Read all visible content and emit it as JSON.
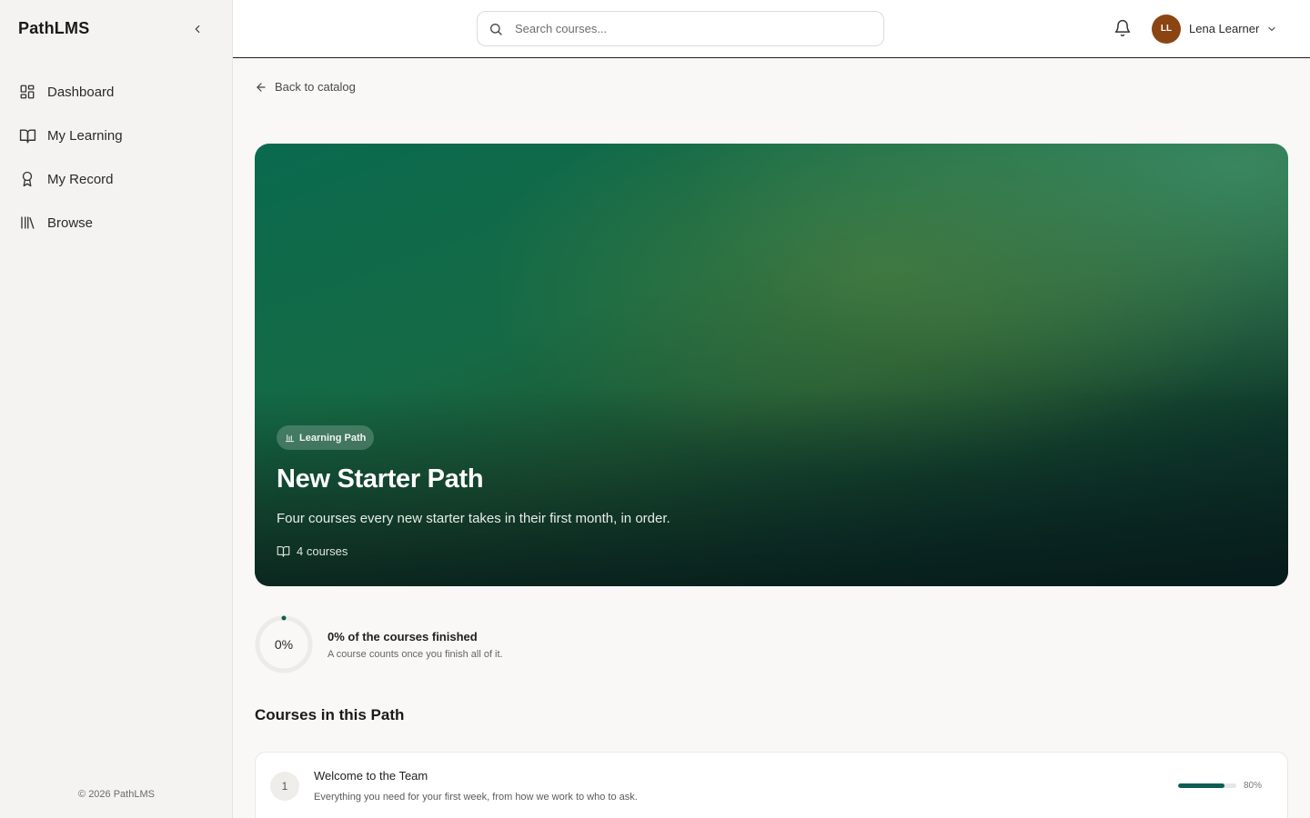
{
  "sidebar": {
    "brand": "PathLMS",
    "items": [
      {
        "label": "Dashboard",
        "icon": "dashboard-icon"
      },
      {
        "label": "My Learning",
        "icon": "book-open-icon"
      },
      {
        "label": "My Record",
        "icon": "award-icon"
      },
      {
        "label": "Browse",
        "icon": "library-icon"
      }
    ],
    "footer": "© 2026 PathLMS"
  },
  "topbar": {
    "search_placeholder": "Search courses...",
    "user": {
      "initials": "LL",
      "name": "Lena Learner",
      "avatar_color": "#8b4513"
    }
  },
  "main": {
    "back_label": "Back to catalog",
    "hero": {
      "badge": "Learning Path",
      "title": "New Starter Path",
      "description": "Four courses every new starter takes in their first month, in order.",
      "meta": "4 courses"
    },
    "progress": {
      "percent_label": "0%",
      "percent": 0,
      "title": "0% of the courses finished",
      "subtitle": "A course counts once you finish all of it."
    },
    "section_title": "Courses in this Path",
    "courses": [
      {
        "number": "1",
        "title": "Welcome to the Team",
        "description": "Everything you need for your first week, from how we work to who to ask.",
        "progress": 80,
        "progress_label": "80%"
      }
    ]
  },
  "colors": {
    "accent": "#0f5c55",
    "hero_green": "#0a6a4e"
  }
}
